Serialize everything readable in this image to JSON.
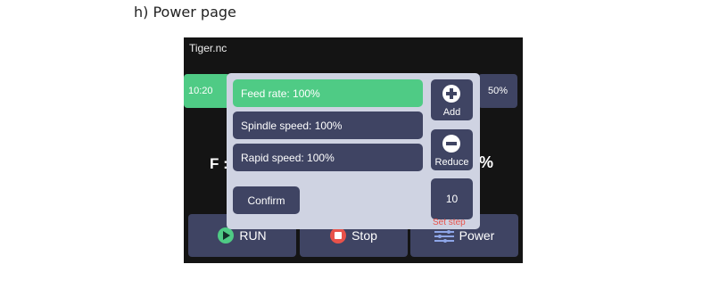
{
  "caption": "h)  Power page",
  "screen": {
    "file_name": "Tiger.nc",
    "background": {
      "progress_left_label": "10:20",
      "progress_right_label": "50%",
      "feed_prefix": "F :",
      "percent_suffix": "%"
    },
    "dialog": {
      "rows": [
        {
          "label": "Feed rate: 100%",
          "active": true
        },
        {
          "label": "Spindle speed: 100%",
          "active": false
        },
        {
          "label": "Rapid speed: 100%",
          "active": false
        }
      ],
      "add_label": "Add",
      "reduce_label": "Reduce",
      "confirm_label": "Confirm",
      "step_value": "10",
      "set_step_label": "Set step"
    },
    "bottom_buttons": {
      "run_label": "RUN",
      "stop_label": "Stop",
      "power_label": "Power"
    }
  },
  "colors": {
    "active_green": "#4fcb85",
    "button_dark": "#3f4463",
    "dialog_bg": "#cfd3e2",
    "screen_bg": "#141414",
    "alert_red": "#e8524a"
  },
  "icons": [
    "add-circle-icon",
    "reduce-circle-icon",
    "run-play-icon",
    "stop-icon",
    "power-sliders-icon"
  ]
}
